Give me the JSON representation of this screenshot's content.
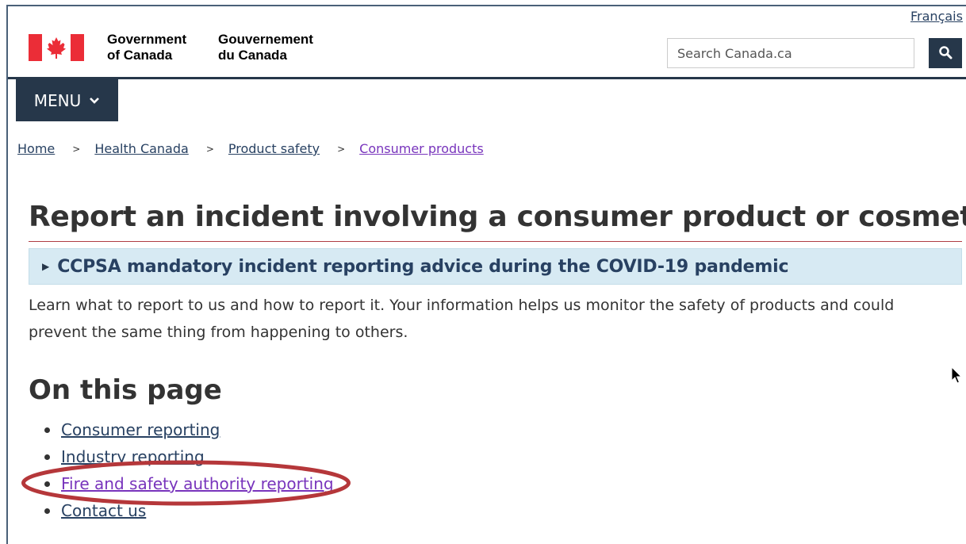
{
  "header": {
    "language_toggle": "Français",
    "signature_en_line1": "Government",
    "signature_en_line2": "of Canada",
    "signature_fr_line1": "Gouvernement",
    "signature_fr_line2": "du Canada",
    "search_placeholder": "Search Canada.ca",
    "search_button_icon": "search-icon",
    "flag_icon": "canada-flag-icon"
  },
  "menu": {
    "label": "MENU",
    "icon": "chevron-down-icon"
  },
  "breadcrumb": [
    {
      "label": "Home"
    },
    {
      "label": "Health Canada"
    },
    {
      "label": "Product safety"
    },
    {
      "label": "Consumer products",
      "visited": true
    }
  ],
  "breadcrumb_separator": ">",
  "main": {
    "title": "Report an incident involving a consumer product or cosmetic",
    "alert_text": "CCPSA mandatory incident reporting advice during the COVID-19 pandemic",
    "intro_line1": "Learn what to report to us and how to report it. Your information helps us monitor the safety of products and could",
    "intro_line2": "prevent the same thing from happening to others.",
    "on_this_page_heading": "On this page",
    "toc": [
      {
        "label": "Consumer reporting"
      },
      {
        "label": "Industry reporting"
      },
      {
        "label": "Fire and safety authority reporting",
        "visited": true,
        "highlighted": true
      },
      {
        "label": "Contact us"
      }
    ]
  },
  "colors": {
    "navy": "#26374a",
    "link": "#284162",
    "visited_link": "#7834bc",
    "title_rule": "#af3c43",
    "alert_bg": "#d7eaf3",
    "annotation": "#b5373a",
    "flag_red": "#eb2d37"
  }
}
